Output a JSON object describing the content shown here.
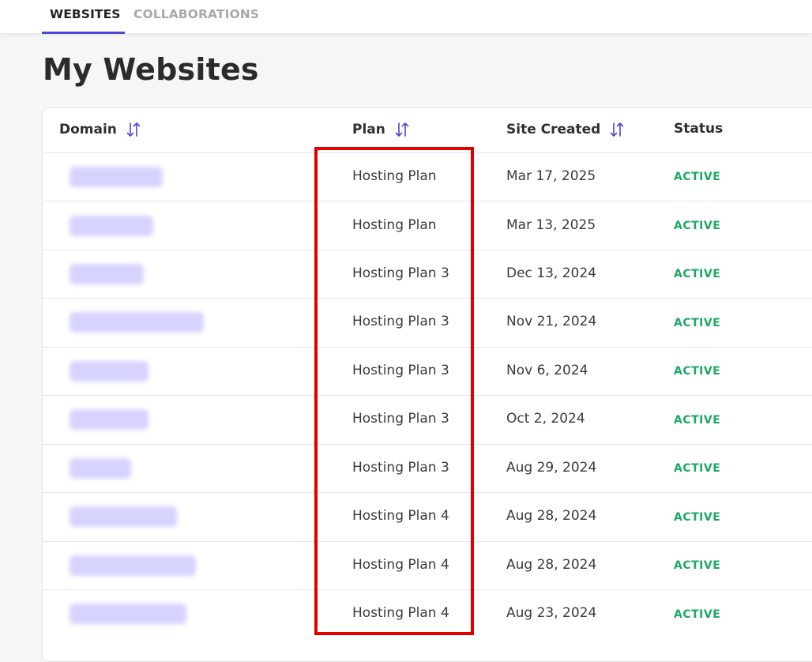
{
  "tabs": [
    {
      "label": "WEBSITES",
      "active": true
    },
    {
      "label": "COLLABORATIONS",
      "active": false
    }
  ],
  "page_title": "My Websites",
  "table": {
    "columns": [
      {
        "label": "Domain",
        "sortable": true
      },
      {
        "label": "Plan",
        "sortable": true
      },
      {
        "label": "Site Created",
        "sortable": true
      },
      {
        "label": "Status",
        "sortable": false
      }
    ],
    "rows": [
      {
        "plan": "Hosting Plan",
        "created": "Mar 17, 2025",
        "status": "ACTIVE"
      },
      {
        "plan": "Hosting Plan",
        "created": "Mar 13, 2025",
        "status": "ACTIVE"
      },
      {
        "plan": "Hosting Plan 3",
        "created": "Dec 13, 2024",
        "status": "ACTIVE"
      },
      {
        "plan": "Hosting Plan 3",
        "created": "Nov 21, 2024",
        "status": "ACTIVE"
      },
      {
        "plan": "Hosting Plan 3",
        "created": "Nov 6, 2024",
        "status": "ACTIVE"
      },
      {
        "plan": "Hosting Plan 3",
        "created": "Oct 2, 2024",
        "status": "ACTIVE"
      },
      {
        "plan": "Hosting Plan 3",
        "created": "Aug 29, 2024",
        "status": "ACTIVE"
      },
      {
        "plan": "Hosting Plan 4",
        "created": "Aug 28, 2024",
        "status": "ACTIVE"
      },
      {
        "plan": "Hosting Plan 4",
        "created": "Aug 28, 2024",
        "status": "ACTIVE"
      },
      {
        "plan": "Hosting Plan 4",
        "created": "Aug 23, 2024",
        "status": "ACTIVE"
      }
    ]
  },
  "icons": {
    "sort": "sort-arrows-icon"
  },
  "colors": {
    "accent": "#4b44d6",
    "status_active": "#1ea866",
    "highlight": "#e00000"
  }
}
